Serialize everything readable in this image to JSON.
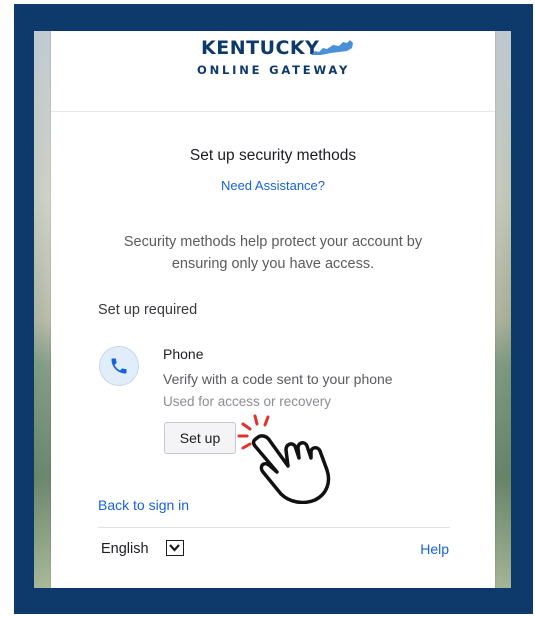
{
  "logo": {
    "name": "KENTUCKY",
    "subtitle": "ONLINE GATEWAY",
    "shape_icon": "kentucky-state-shape",
    "color": "#0e3a6b",
    "shape_color": "#4a90d9"
  },
  "heading": "Set up security methods",
  "assistance_link": "Need Assistance?",
  "description": "Security methods help protect your account by ensuring only you have access.",
  "section_label": "Set up required",
  "method": {
    "icon": "phone-icon",
    "name": "Phone",
    "description": "Verify with a code sent to your phone",
    "note": "Used for access or recovery",
    "button_label": "Set up"
  },
  "pointer_icon": "hand-pointer-icon",
  "back_link": "Back to sign in",
  "footer": {
    "language": "English",
    "language_icon": "chevron-down-icon",
    "help": "Help"
  },
  "colors": {
    "frame": "#0e3a6b",
    "link": "#1662dd",
    "click_burst": "#e4322b"
  }
}
